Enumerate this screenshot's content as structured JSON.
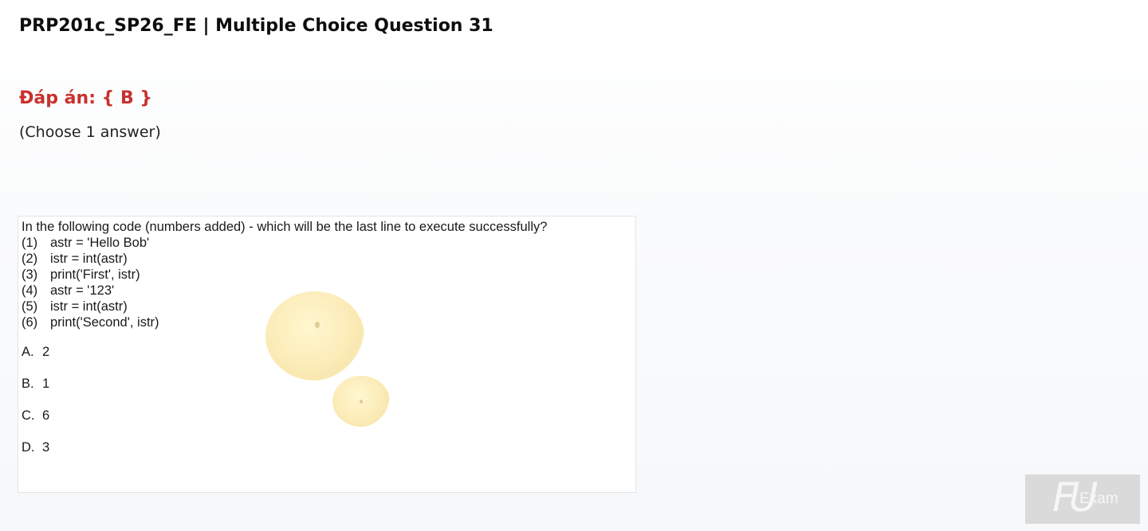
{
  "header": {
    "title": "PRP201c_SP26_FE | Multiple Choice Question 31"
  },
  "answer": {
    "text": "Đáp án: { B }",
    "color": "#c8312f"
  },
  "instruction": "(Choose 1 answer)",
  "question": {
    "prompt": "In the following code (numbers added) - which will be the last line to execute successfully?",
    "code_lines": [
      {
        "num": "(1)",
        "code": "astr = 'Hello Bob'"
      },
      {
        "num": "(2)",
        "code": "istr = int(astr)"
      },
      {
        "num": "(3)",
        "code": "print('First', istr)"
      },
      {
        "num": "(4)",
        "code": "astr = '123'"
      },
      {
        "num": "(5)",
        "code": "istr = int(astr)"
      },
      {
        "num": "(6)",
        "code": "print('Second', istr)"
      }
    ],
    "options": [
      {
        "letter": "A.",
        "value": "2"
      },
      {
        "letter": "B.",
        "value": "1"
      },
      {
        "letter": "C.",
        "value": "6"
      },
      {
        "letter": "D.",
        "value": "3"
      }
    ]
  },
  "logo": {
    "mark": "FU",
    "text": "Exam"
  }
}
